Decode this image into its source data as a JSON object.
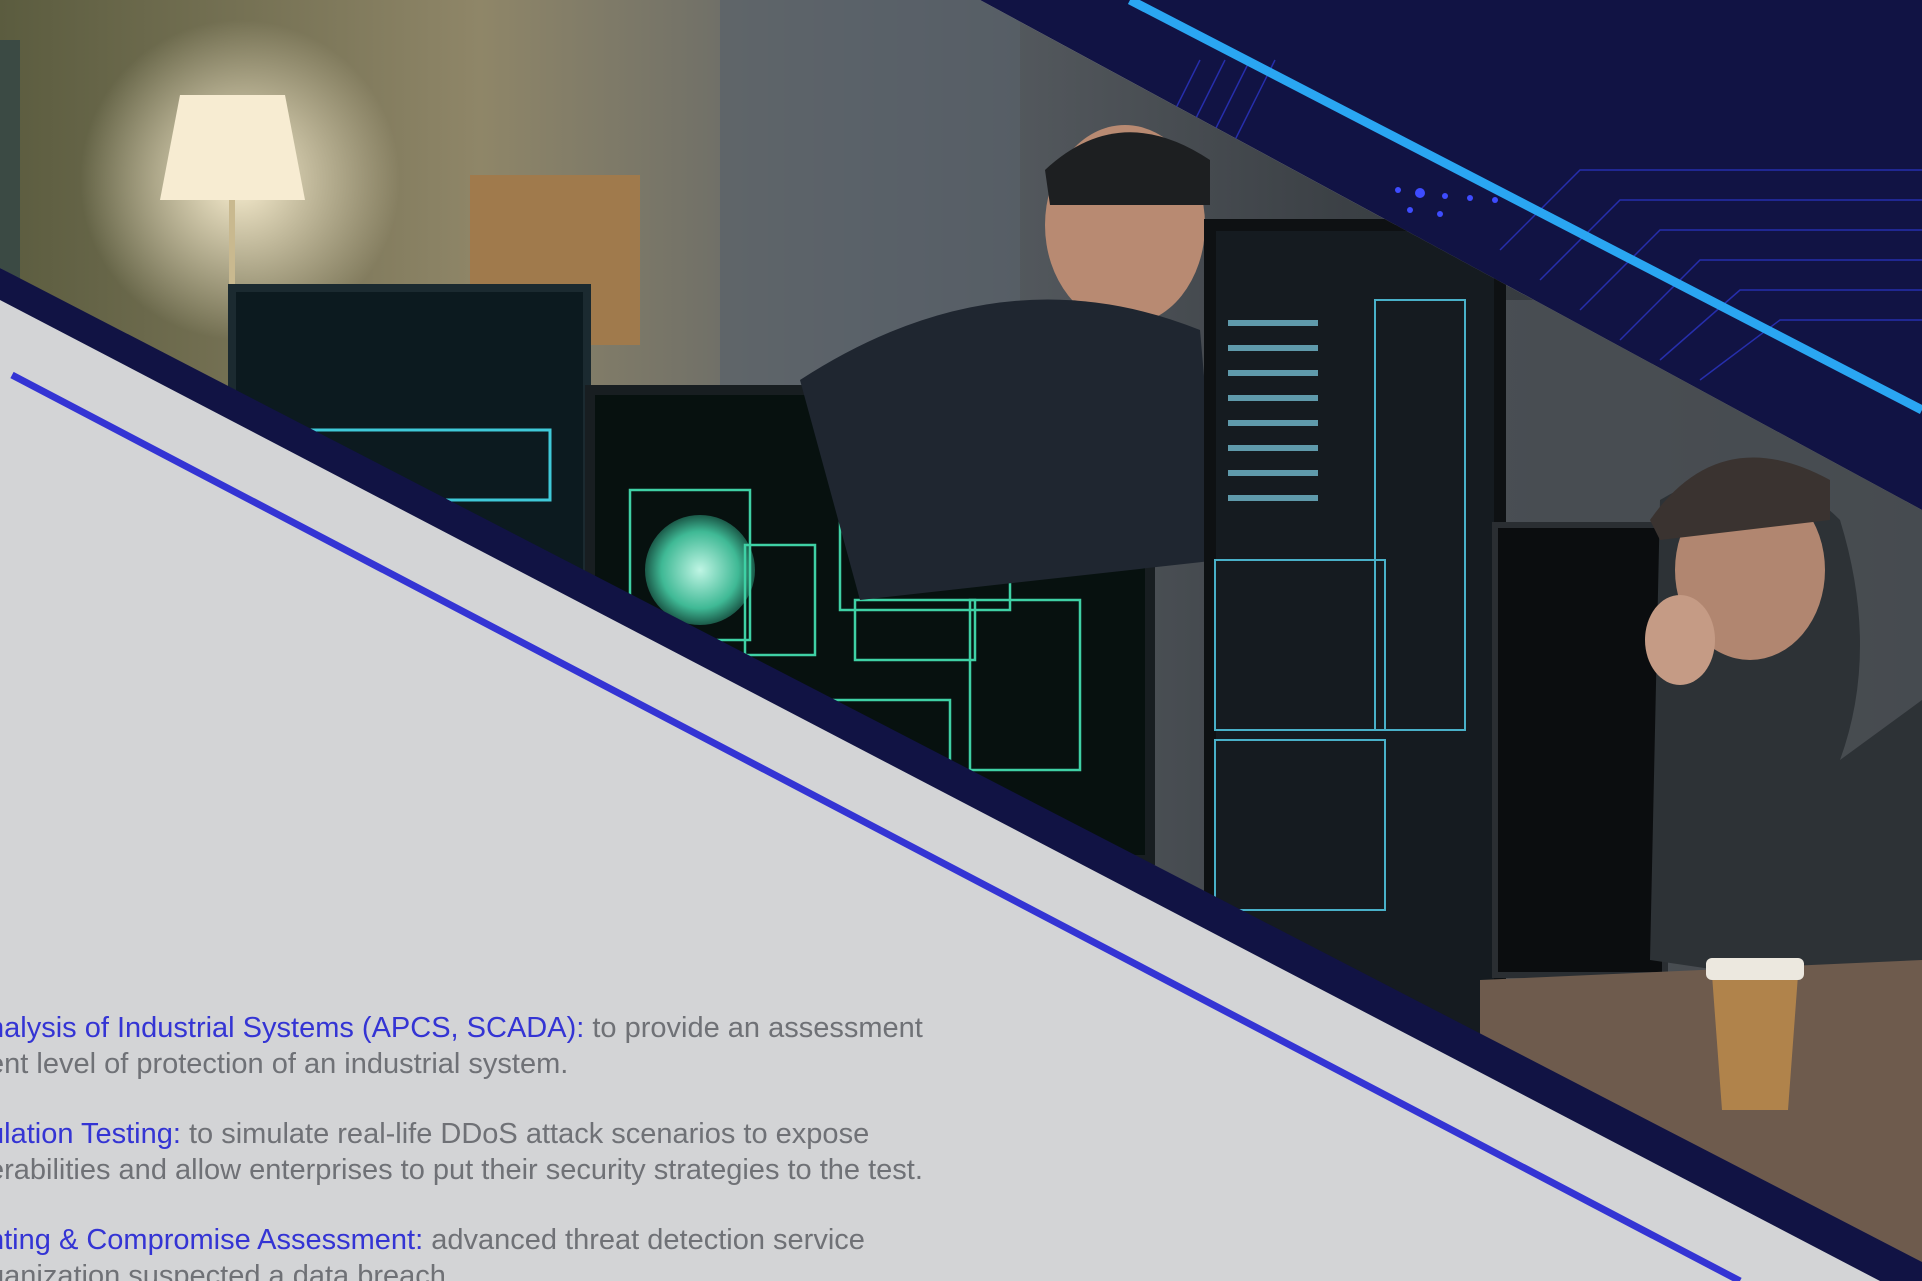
{
  "page": {
    "colors": {
      "background": "#d3d4d6",
      "navy": "#111344",
      "accent_blue": "#3434d4",
      "light_blue": "#2aa6f2",
      "text_grey": "#6f7176"
    }
  },
  "services": [
    {
      "title": "nalysis of Industrial Systems (APCS, SCADA):",
      "desc_line1": " to provide an assessment",
      "desc_line2": "ent level of protection of an industrial system."
    },
    {
      "title": "ulation Testing:",
      "desc_line1": " to simulate real-life DDoS attack scenarios to expose",
      "desc_line2": "erabilities and allow enterprises to put their security strategies to the test."
    },
    {
      "title": "nting & Compromise Assessment:",
      "desc_line1": " advanced threat detection service",
      "desc_line2": "ganization suspected a data breach."
    }
  ]
}
